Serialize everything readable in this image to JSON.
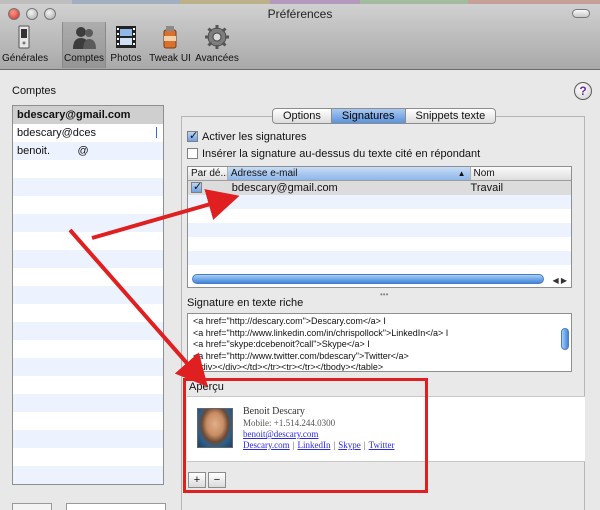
{
  "window": {
    "title": "Préférences"
  },
  "toolbar": {
    "items": [
      {
        "label": "Générales",
        "icon": "light-switch-icon"
      },
      {
        "label": "Comptes",
        "icon": "accounts-people-icon",
        "selected": true
      },
      {
        "label": "Photos",
        "icon": "film-strip-icon"
      },
      {
        "label": "Tweak UI",
        "icon": "tweak-ui-can-icon"
      },
      {
        "label": "Avancées",
        "icon": "gear-icon"
      }
    ]
  },
  "accounts": {
    "label": "Comptes",
    "items": [
      {
        "name": "bdescary@gmail.com",
        "selected": true
      },
      {
        "name": "bdescary@dces"
      },
      {
        "name": "benoit.         @"
      }
    ]
  },
  "help": {
    "glyph": "?"
  },
  "tabs": [
    {
      "label": "Options"
    },
    {
      "label": "Signatures",
      "active": true
    },
    {
      "label": "Snippets texte"
    }
  ],
  "signatures": {
    "enable_label": "Activer les signatures",
    "enable_checked": true,
    "insert_above_label": "Insérer la signature au-dessus du texte cité en répondant",
    "insert_above_checked": false,
    "columns": {
      "default": "Par dé...",
      "email": "Adresse e-mail",
      "name": "Nom"
    },
    "rows": [
      {
        "default": true,
        "email": "bdescary@gmail.com",
        "name": "Travail"
      }
    ]
  },
  "rich_text": {
    "title": "Signature en texte riche",
    "lines": [
      "<a href=\"http://descary.com\">Descary.com</a> I",
      "<a href=\"http://www.linkedin.com/in/chrispollock\">LinkedIn</a> I",
      "<a href=\"skype:dcebenoit?call\">Skype</a> I",
      " <a href=\"http://www.twitter.com/bdescary\">Twitter</a>",
      "</div></div></td></tr><tr></tr></tbody></table>"
    ]
  },
  "preview": {
    "label": "Aperçu",
    "name": "Benoit Descary",
    "mobile": "Mobile: +1.514.244.0300",
    "email": "benoit@descary.com",
    "links": [
      "Descary.com",
      "LinkedIn",
      "Skype",
      "Twitter"
    ],
    "separator": "|"
  },
  "buttons": {
    "add": "+",
    "remove": "−"
  },
  "colors": {
    "annotation_red": "#e02020",
    "selection_blue": "#5b93dc"
  }
}
